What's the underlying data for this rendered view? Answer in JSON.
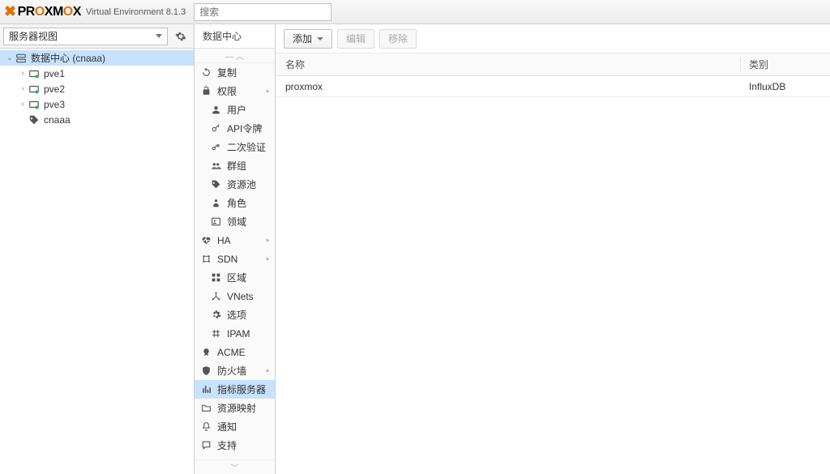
{
  "header": {
    "product": "PROXMOX",
    "subtitle": "Virtual Environment 8.1.3",
    "search_placeholder": "搜索"
  },
  "view_selector": {
    "label": "服务器视图"
  },
  "tree": {
    "root": {
      "label": "数据中心 (cnaaa)"
    },
    "nodes": [
      {
        "label": "pve1"
      },
      {
        "label": "pve2"
      },
      {
        "label": "pve3"
      }
    ],
    "pool": {
      "label": "cnaaa"
    }
  },
  "mid": {
    "title": "数据中心",
    "items": [
      {
        "key": "replication",
        "label": "复制",
        "icon": "refresh"
      },
      {
        "key": "permissions",
        "label": "权限",
        "icon": "unlock",
        "expand": true
      },
      {
        "key": "users",
        "label": "用户",
        "icon": "user",
        "sub": true
      },
      {
        "key": "apitokens",
        "label": "API令牌",
        "icon": "key",
        "sub": true
      },
      {
        "key": "twofactor",
        "label": "二次验证",
        "icon": "keys",
        "sub": true
      },
      {
        "key": "groups",
        "label": "群组",
        "icon": "group",
        "sub": true
      },
      {
        "key": "pools",
        "label": "资源池",
        "icon": "tags",
        "sub": true
      },
      {
        "key": "roles",
        "label": "角色",
        "icon": "person",
        "sub": true
      },
      {
        "key": "realms",
        "label": "领域",
        "icon": "address",
        "sub": true
      },
      {
        "key": "ha",
        "label": "HA",
        "icon": "heartbeat",
        "expand": true
      },
      {
        "key": "sdn",
        "label": "SDN",
        "icon": "sdn",
        "expand": true
      },
      {
        "key": "zones",
        "label": "区域",
        "icon": "th",
        "sub": true
      },
      {
        "key": "vnets",
        "label": "VNets",
        "icon": "network",
        "sub": true
      },
      {
        "key": "options_sdn",
        "label": "选项",
        "icon": "gear",
        "sub": true
      },
      {
        "key": "ipam",
        "label": "IPAM",
        "icon": "ipam",
        "sub": true
      },
      {
        "key": "acme",
        "label": "ACME",
        "icon": "cert"
      },
      {
        "key": "firewall",
        "label": "防火墙",
        "icon": "shield",
        "expand": true
      },
      {
        "key": "metrics",
        "label": "指标服务器",
        "icon": "chart",
        "selected": true
      },
      {
        "key": "resmapping",
        "label": "资源映射",
        "icon": "folder"
      },
      {
        "key": "notify",
        "label": "通知",
        "icon": "bell"
      },
      {
        "key": "support",
        "label": "支持",
        "icon": "comment"
      }
    ]
  },
  "toolbar": {
    "add": "添加",
    "edit": "编辑",
    "remove": "移除"
  },
  "grid": {
    "headers": {
      "name": "名称",
      "type": "类别"
    },
    "rows": [
      {
        "name": "proxmox",
        "type": "InfluxDB"
      }
    ]
  }
}
